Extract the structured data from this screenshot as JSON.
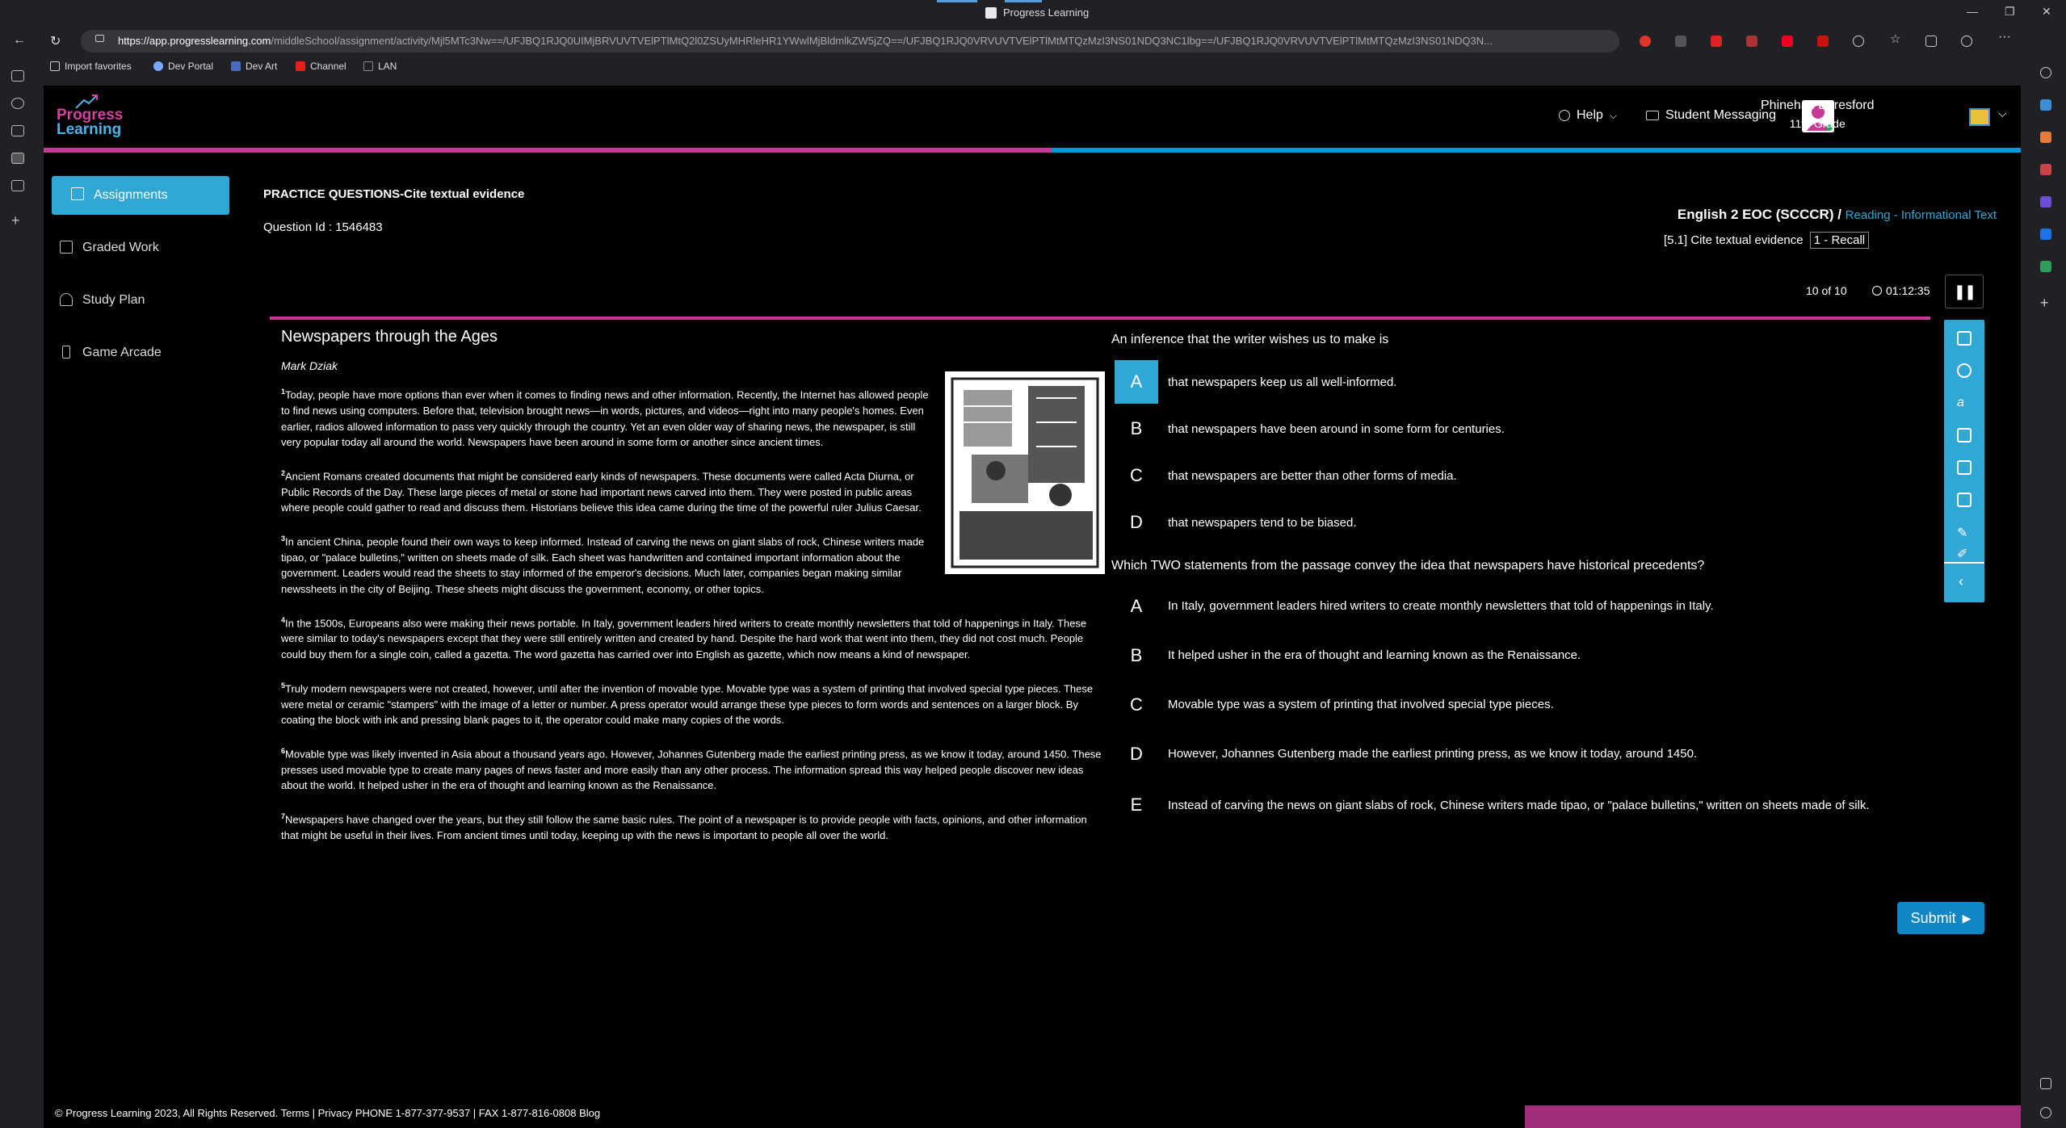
{
  "browser": {
    "tab_title": "Progress Learning",
    "url_host": "https://app.progresslearning.com",
    "url_rest": "/middleSchool/assignment/activity/Mjl5MTc3Nw==/UFJBQ1RJQ0UIMjBRVUVTVElPTlMtQ2l0ZSUyMHRleHR1YWwlMjBldmlkZW5jZQ==/UFJBQ1RJQ0VRVUVTVElPTlMtMTQzMzI3NS01NDQ3NC1lbg==/UFJBQ1RJQ0VRVUVTVElPTlMtMTQzMzI3NS01NDQ3N...",
    "bookmarks": [
      "Import favorites",
      "Dev Portal",
      "Dev Art",
      "Channel",
      "LAN"
    ]
  },
  "header": {
    "logo_line1": "Progress",
    "logo_line2": "Learning",
    "help": "Help",
    "messaging": "Student Messaging",
    "user_name": "Phinehas Beresford",
    "user_grade": "11th Grade",
    "progress_fraction": 0.51
  },
  "sidebar": {
    "items": [
      {
        "label": "Assignments",
        "icon": "assignments-icon"
      },
      {
        "label": "Graded Work",
        "icon": "graded-work-icon"
      },
      {
        "label": "Study Plan",
        "icon": "study-plan-icon"
      },
      {
        "label": "Game Arcade",
        "icon": "game-arcade-icon"
      }
    ]
  },
  "question_info": {
    "title": "PRACTICE QUESTIONS-Cite textual evidence",
    "question_id": "Question Id : 1546483",
    "course": "English 2 EOC (SCCCR) /",
    "category": "Reading - Informational Text",
    "standard": "[5.1] Cite textual evidence",
    "dok": "1 - Recall",
    "counter": "10 of 10",
    "timer": "01:12:35"
  },
  "passage": {
    "title": "Newspapers through the Ages",
    "author": "Mark Dziak",
    "paragraphs": [
      {
        "n": "1",
        "text": "Today, people have more options than ever when it comes to finding news and other information. Recently, the Internet has allowed people to find news using computers. Before that, television brought news—in words, pictures, and videos—right into many people's homes. Even earlier, radios allowed information to pass very quickly through the country. Yet an even older way of sharing news, the newspaper, is still very popular today all around the world. Newspapers have been around in some form or another since ancient times."
      },
      {
        "n": "2",
        "text": "Ancient Romans created documents that might be considered early kinds of newspapers. These documents were called Acta Diurna, or Public Records of the Day. These large pieces of metal or stone had important news carved into them. They were posted in public areas where people could gather to read and discuss them. Historians believe this idea came during the time of the powerful ruler Julius Caesar."
      },
      {
        "n": "3",
        "text": "In ancient China, people found their own ways to keep informed. Instead of carving the news on giant slabs of rock, Chinese writers made tipao, or \"palace bulletins,\" written on sheets made of silk. Each sheet was handwritten and contained important information about the government. Leaders would read the sheets to stay informed of the emperor's decisions. Much later, companies began making similar newssheets in the city of Beijing. These sheets might discuss the government, economy, or other topics."
      },
      {
        "n": "4",
        "text": "In the 1500s, Europeans also were making their news portable. In Italy, government leaders hired writers to create monthly newsletters that told of happenings in Italy. These were similar to today's newspapers except that they were still entirely written and created by hand. Despite the hard work that went into them, they did not cost much. People could buy them for a single coin, called a gazetta. The word gazetta has carried over into English as gazette, which now means a kind of newspaper."
      },
      {
        "n": "5",
        "text": "Truly modern newspapers were not created, however, until after the invention of movable type. Movable type was a system of printing that involved special type pieces. These were metal or ceramic \"stampers\" with the image of a letter or number. A press operator would arrange these type pieces to form words and sentences on a larger block. By coating the block with ink and pressing blank pages to it, the operator could make many copies of the words."
      },
      {
        "n": "6",
        "text": "Movable type was likely invented in Asia about a thousand years ago. However, Johannes Gutenberg made the earliest printing press, as we know it today, around 1450. These presses used movable type to create many pages of news faster and more easily than any other process. The information spread this way helped people discover new ideas about the world. It helped usher in the era of thought and learning known as the Renaissance."
      },
      {
        "n": "7",
        "text": "Newspapers have changed over the years, but they still follow the same basic rules. The point of a newspaper is to provide people with facts, opinions, and other information that might be useful in their lives. From ancient times until today, keeping up with the news is important to people all over the world."
      }
    ]
  },
  "part_a": {
    "stem": "An inference that the writer wishes us to make is",
    "selected": "A",
    "options": [
      {
        "letter": "A",
        "text": "that newspapers keep us all well-informed."
      },
      {
        "letter": "B",
        "text": "that newspapers have been around in some form for centuries."
      },
      {
        "letter": "C",
        "text": "that newspapers are better than other forms of media."
      },
      {
        "letter": "D",
        "text": "that newspapers tend to be biased."
      }
    ]
  },
  "part_b": {
    "stem": "Which TWO statements from the passage convey the idea that newspapers have historical precedents?",
    "options": [
      {
        "letter": "A",
        "text": "In Italy, government leaders hired writers to create monthly newsletters that told of happenings in Italy."
      },
      {
        "letter": "B",
        "text": "It helped usher in the era of thought and learning known as the Renaissance."
      },
      {
        "letter": "C",
        "text": "Movable type was a system of printing that involved special type pieces."
      },
      {
        "letter": "D",
        "text": "However, Johannes Gutenberg made the earliest printing press, as we know it today, around 1450."
      },
      {
        "letter": "E",
        "text": "Instead of carving the news on giant slabs of rock, Chinese writers made tipao, or \"palace bulletins,\" written on sheets made of silk."
      }
    ]
  },
  "submit_label": "Submit",
  "footer": "© Progress Learning 2023, All Rights Reserved.   Terms   |   Privacy   PHONE 1-877-377-9537   |   FAX 1-877-816-0808   Blog"
}
